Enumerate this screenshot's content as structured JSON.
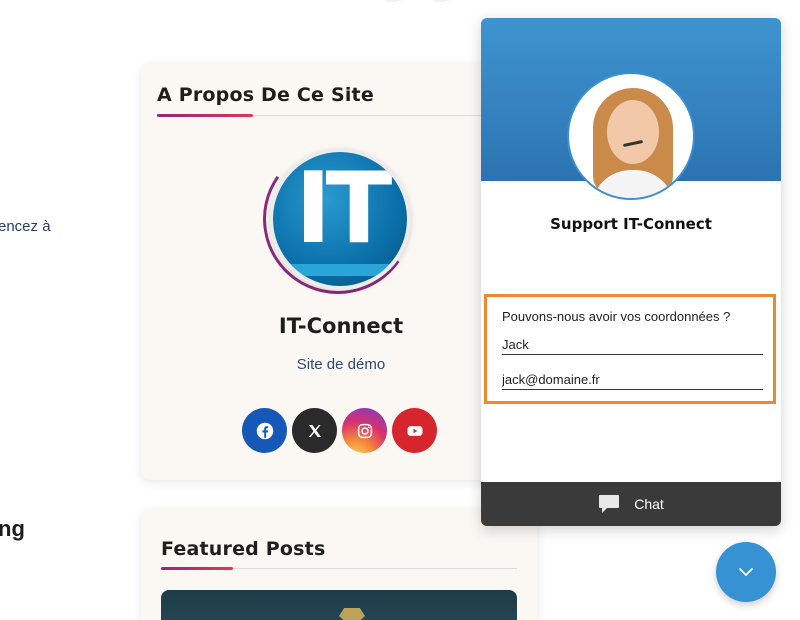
{
  "background": {
    "partial_text_1": "encez à",
    "partial_text_2": "ng"
  },
  "about_card": {
    "title": "A Propos De Ce Site",
    "logo_text": "IT",
    "site_name": "IT-Connect",
    "site_subtitle": "Site de démo",
    "socials": [
      {
        "name": "facebook",
        "icon": "facebook-icon",
        "color": "#1558b8"
      },
      {
        "name": "x",
        "icon": "x-icon",
        "color": "#2a2a2a"
      },
      {
        "name": "instagram",
        "icon": "instagram-icon",
        "color": "#d9316c"
      },
      {
        "name": "youtube",
        "icon": "youtube-icon",
        "color": "#d7252d"
      }
    ]
  },
  "featured_posts": {
    "title": "Featured Posts"
  },
  "chat_widget": {
    "agent_name": "Support IT-Connect",
    "form_prompt": "Pouvons-nous avoir vos coordonnées ?",
    "name_value": "Jack",
    "email_value": "jack@domaine.fr",
    "footer_label": "Chat",
    "header_color": "#3e94d0",
    "highlight_color": "#f0882e"
  },
  "fab": {
    "icon": "chevron-down-icon",
    "color": "#3792d4"
  }
}
